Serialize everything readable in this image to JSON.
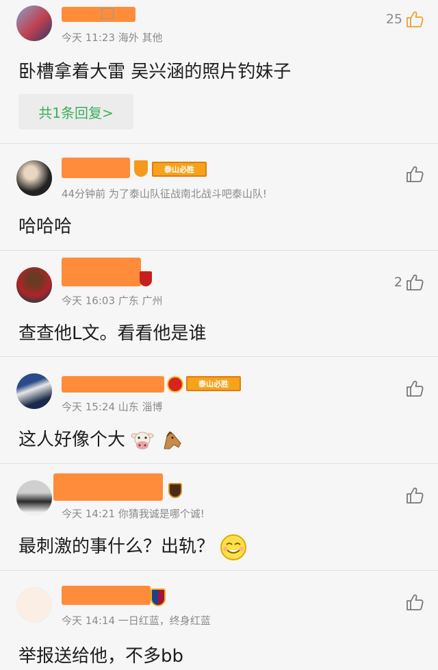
{
  "comments": [
    {
      "meta": "今天 11:23 海外 其他",
      "text": "卧槽拿着大雷 吴兴涵的照片钓妹子",
      "likes": "25",
      "reply": "共1条回复>"
    },
    {
      "meta": "44分钟前 为了泰山队征战南北战斗吧泰山队!",
      "text": "哈哈哈",
      "likes": "",
      "badge": "泰山必胜"
    },
    {
      "meta": "今天 16:03 广东 广州",
      "text": "查查他L文。看看他是谁",
      "likes": "2"
    },
    {
      "meta": "今天 15:24 山东 淄博",
      "text": "这人好像个大",
      "likes": "",
      "badge": "泰山必胜"
    },
    {
      "meta": "今天 14:21 你猜我诚是哪个诚!",
      "text": "最刺激的事什么？出轨？",
      "likes": ""
    },
    {
      "meta": "今天 14:14 一日红蓝，终身红蓝",
      "text": "举报送给他，不多bb",
      "likes": ""
    }
  ],
  "colors": {
    "like_active": "#f0a030",
    "like_inactive": "#777777",
    "reply_text": "#3cae5a",
    "redaction": "#ff8c3a",
    "badge_gold": "#f7a21b"
  }
}
